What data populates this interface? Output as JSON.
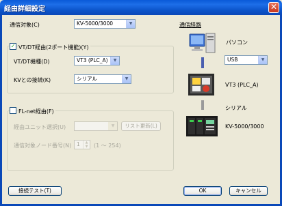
{
  "window": {
    "title": "経由詳細設定",
    "close_glyph": "✕"
  },
  "comm_target": {
    "label": "通信対象(C)",
    "value": "KV-5000/3000"
  },
  "vt_dt": {
    "checkbox_label": "VT/DT経由(2ポート機能)(Y)",
    "checked": true,
    "model_label": "VT/DT機種(D)",
    "model_value": "VT3 (PLC_A)",
    "kv_conn_label": "KVとの接続(K)",
    "kv_conn_value": "シリアル"
  },
  "fl_net": {
    "checkbox_label": "FL-net経由(F)",
    "checked": false,
    "unit_label": "経由ユニット選択(U)",
    "unit_value": "",
    "list_update_button": "リスト更新(L)",
    "node_label": "通信対象ノード番号(N)",
    "node_value": "1",
    "node_range": "(1 〜 254)"
  },
  "route": {
    "title": "通信経路",
    "pc_label": "パソコン",
    "pc_conn_value": "USB",
    "vt_label": "VT3 (PLC_A)",
    "serial_label": "シリアル",
    "plc_label": "KV-5000/3000",
    "connector_colors": {
      "usb": "#4a5fb0",
      "serial": "#9a9a9a"
    }
  },
  "buttons": {
    "test": "接続テスト(T)",
    "ok": "OK",
    "cancel": "キャンセル"
  },
  "icons": {
    "pc": "computer-icon",
    "vt": "touch-panel-icon",
    "plc": "plc-icon",
    "dropdown": "▼"
  }
}
